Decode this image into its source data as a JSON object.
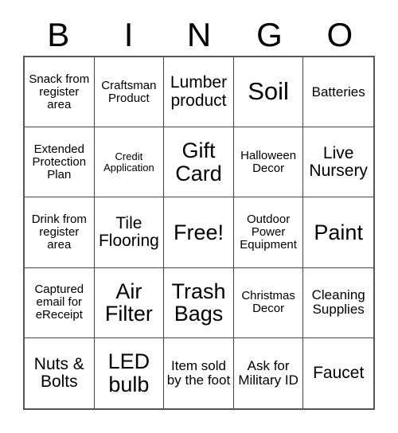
{
  "card": {
    "title": "BINGO",
    "header_letters": [
      "B",
      "I",
      "N",
      "G",
      "O"
    ],
    "colors": {
      "background": "#ffffff",
      "text": "#000000",
      "grid_line": "#444444",
      "grid_outer_border": "#555555"
    },
    "grid": {
      "columns": 5,
      "rows": 5,
      "free_space_label": "Free!",
      "free_space_position": "row3-col3"
    },
    "cells": [
      {
        "text": "Snack from register area",
        "size": "fs-sm"
      },
      {
        "text": "Craftsman Product",
        "size": "fs-sm"
      },
      {
        "text": "Lumber product",
        "size": "fs-lg"
      },
      {
        "text": "Soil",
        "size": "fs-xxl"
      },
      {
        "text": "Batteries",
        "size": "fs-md"
      },
      {
        "text": "Extended Protection Plan",
        "size": "fs-sm"
      },
      {
        "text": "Credit Application",
        "size": "fs-xs"
      },
      {
        "text": "Gift Card",
        "size": "fs-xl"
      },
      {
        "text": "Halloween Decor",
        "size": "fs-sm"
      },
      {
        "text": "Live Nursery",
        "size": "fs-lg"
      },
      {
        "text": "Drink from register area",
        "size": "fs-sm"
      },
      {
        "text": "Tile Flooring",
        "size": "fs-lg"
      },
      {
        "text": "Free!",
        "size": "fs-xl"
      },
      {
        "text": "Outdoor Power Equipment",
        "size": "fs-sm"
      },
      {
        "text": "Paint",
        "size": "fs-xl"
      },
      {
        "text": "Captured email for eReceipt",
        "size": "fs-sm"
      },
      {
        "text": "Air Filter",
        "size": "fs-xl"
      },
      {
        "text": "Trash Bags",
        "size": "fs-xl"
      },
      {
        "text": "Christmas Decor",
        "size": "fs-sm"
      },
      {
        "text": "Cleaning Supplies",
        "size": "fs-md"
      },
      {
        "text": "Nuts & Bolts",
        "size": "fs-lg"
      },
      {
        "text": "LED bulb",
        "size": "fs-xl"
      },
      {
        "text": "Item sold by the foot",
        "size": "fs-md"
      },
      {
        "text": "Ask for Military ID",
        "size": "fs-md"
      },
      {
        "text": "Faucet",
        "size": "fs-lg"
      }
    ]
  }
}
